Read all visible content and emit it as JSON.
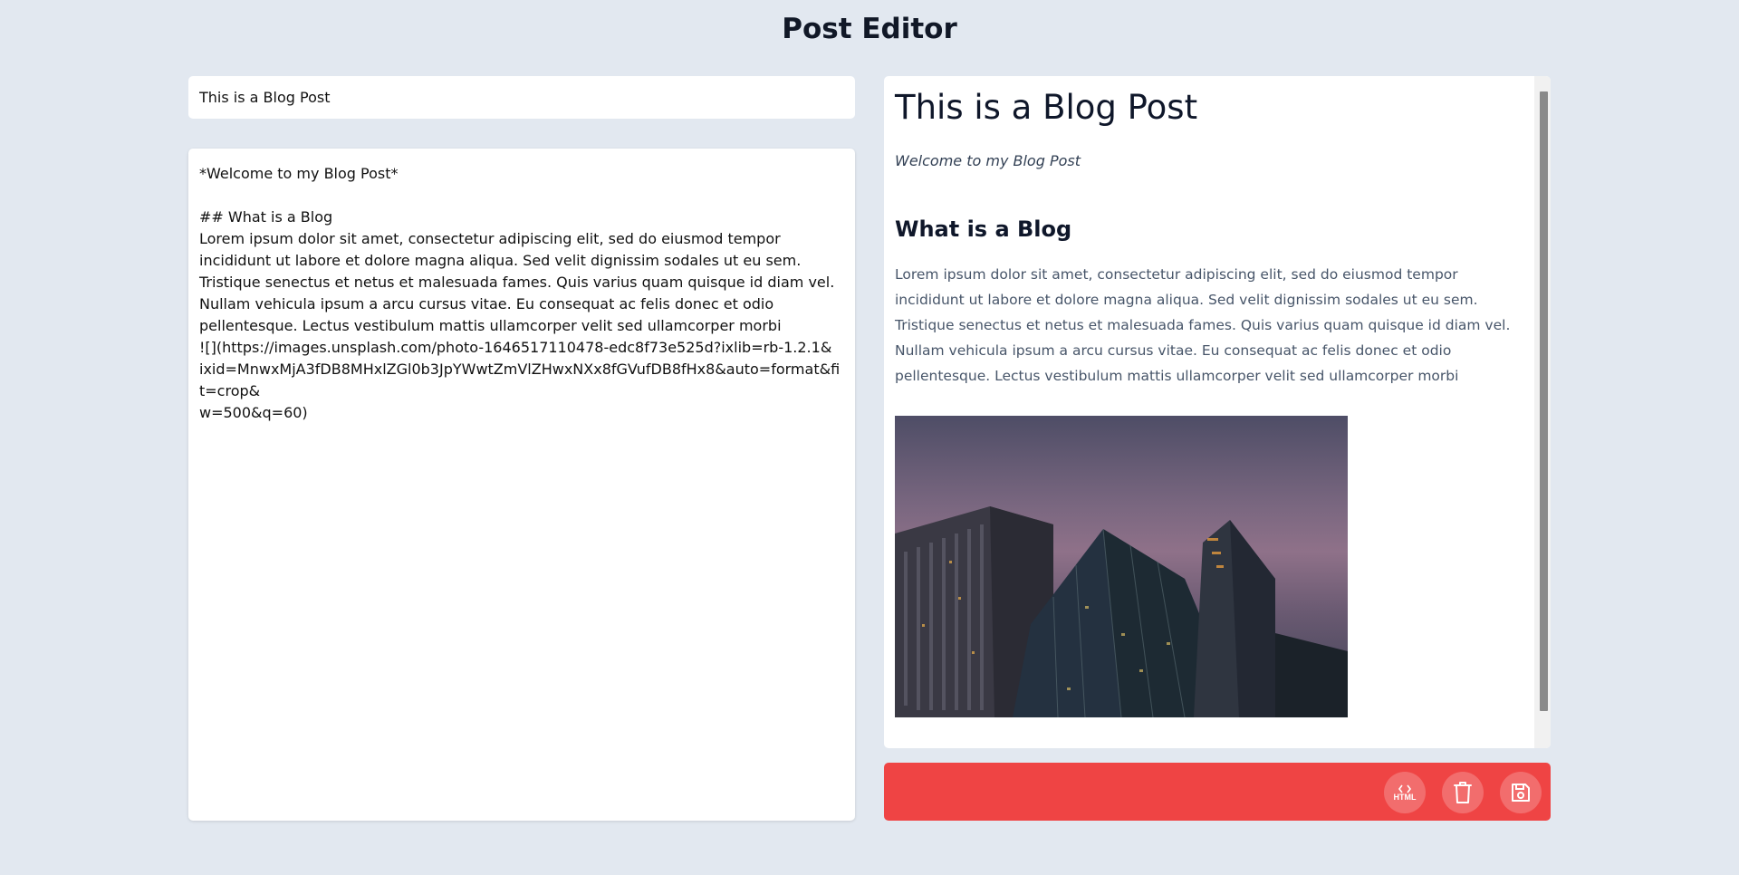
{
  "header": {
    "title": "Post Editor"
  },
  "editor": {
    "title_value": "This is a Blog Post",
    "body_value": "*Welcome to my Blog Post*\n\n## What is a Blog\nLorem ipsum dolor sit amet, consectetur adipiscing elit, sed do eiusmod tempor incididunt ut labore et dolore magna aliqua. Sed velit dignissim sodales ut eu sem. Tristique senectus et netus et malesuada fames. Quis varius quam quisque id diam vel. Nullam vehicula ipsum a arcu cursus vitae. Eu consequat ac felis donec et odio pellentesque. Lectus vestibulum mattis ullamcorper velit sed ullamcorper morbi\n![](https://images.unsplash.com/photo-1646517110478-edc8f73e525d?ixlib=rb-1.2.1&\nixid=MnwxMjA3fDB8MHxlZGl0b3JpYWwtZmVlZHwxNXx8fGVufDB8fHx8&auto=format&fit=crop&\nw=500&q=60)"
  },
  "preview": {
    "h1": "This is a Blog Post",
    "intro": "Welcome to my Blog Post",
    "h2": "What is a Blog",
    "paragraph": "Lorem ipsum dolor sit amet, consectetur adipiscing elit, sed do eiusmod tempor incididunt ut labore et dolore magna aliqua. Sed velit dignissim sodales ut eu sem. Tristique senectus et netus et malesuada fames. Quis varius quam quisque id diam vel. Nullam vehicula ipsum a arcu cursus vitae. Eu consequat ac felis donec et odio pellentesque. Lectus vestibulum mattis ullamcorper velit sed ullamcorper morbi"
  },
  "actions": {
    "html_label": "HTML",
    "icons": [
      "code-icon",
      "trash-icon",
      "save-icon"
    ]
  },
  "colors": {
    "background": "#e2e8f0",
    "action_bar": "#ef4444"
  }
}
